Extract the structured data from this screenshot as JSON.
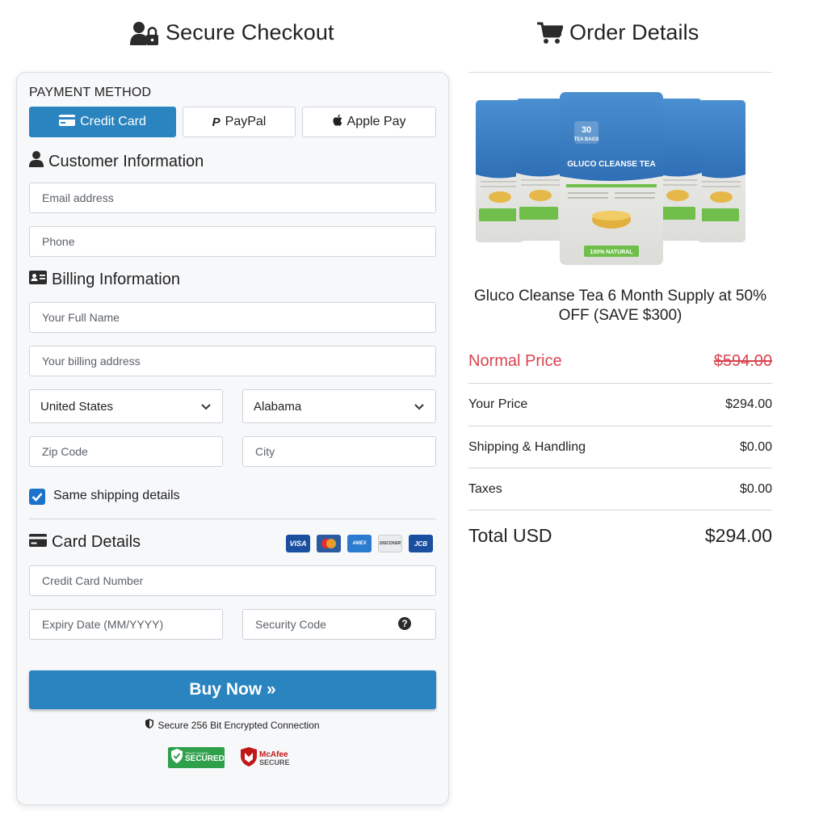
{
  "headings": {
    "checkout": "Secure Checkout",
    "order": "Order Details"
  },
  "payment": {
    "section_label": "PAYMENT METHOD",
    "methods": [
      {
        "label": "Credit Card",
        "icon": "credit-card-icon",
        "active": true
      },
      {
        "label": "PayPal",
        "icon": "paypal-icon",
        "active": false
      },
      {
        "label": "Apple Pay",
        "icon": "apple-icon",
        "active": false
      }
    ]
  },
  "customer": {
    "title": "Customer Information",
    "email_placeholder": "Email address",
    "phone_placeholder": "Phone"
  },
  "billing": {
    "title": "Billing Information",
    "name_placeholder": "Your Full Name",
    "address_placeholder": "Your billing address",
    "country_value": "United States",
    "state_value": "Alabama",
    "zip_placeholder": "Zip Code",
    "city_placeholder": "City",
    "same_shipping_label": "Same shipping details",
    "same_shipping_checked": true
  },
  "card": {
    "title": "Card Details",
    "logos": [
      "VISA",
      "MC",
      "AMEX",
      "DISCOVER",
      "JCB"
    ],
    "number_placeholder": "Credit Card Number",
    "expiry_placeholder": "Expiry Date (MM/YYYY)",
    "cvv_placeholder": "Security Code"
  },
  "actions": {
    "buy_label": "Buy Now »",
    "secure_text": "Secure 256 Bit Encrypted Connection"
  },
  "badges": {
    "trust_top": "TRUST GUARD",
    "trust_main": "SECURED",
    "mcafee_top": "McAfee",
    "mcafee_bottom": "SECURE"
  },
  "order": {
    "product_title": "Gluco Cleanse Tea 6 Month Supply at 50% OFF (SAVE $300)",
    "package_text": {
      "bags": "30",
      "bags_label": "TEA BAGS",
      "brand": "GLUCO CLEANSE TEA",
      "natural": "100% NATURAL"
    },
    "rows": [
      {
        "label": "Normal Price",
        "value": "$594.00"
      },
      {
        "label": "Your Price",
        "value": "$294.00"
      },
      {
        "label": "Shipping & Handling",
        "value": "$0.00"
      },
      {
        "label": "Taxes",
        "value": "$0.00"
      }
    ],
    "total_label": "Total USD",
    "total_value": "$294.00"
  },
  "colors": {
    "primary": "#2a84bf",
    "danger": "#d9434f",
    "check": "#1a73c9",
    "panel_bg": "#f7f8fa"
  }
}
